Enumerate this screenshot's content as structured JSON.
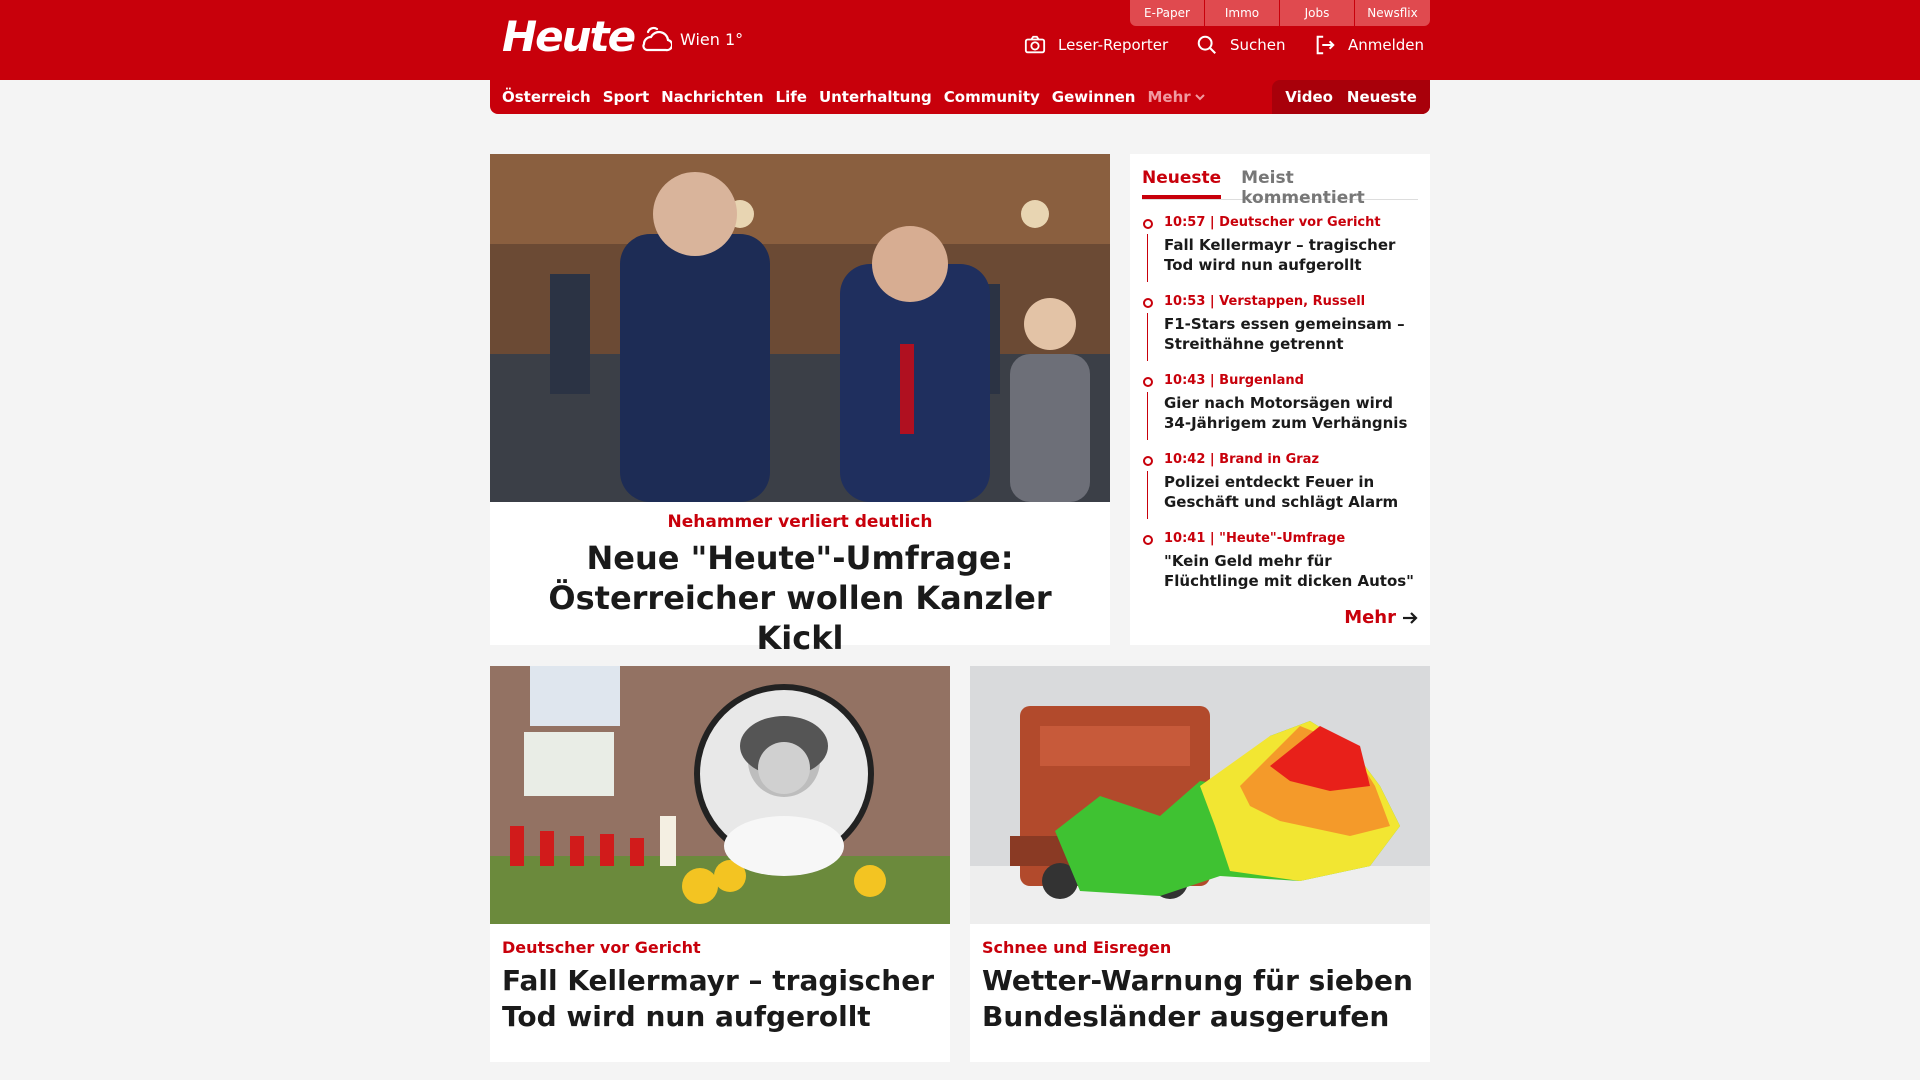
{
  "brand": {
    "logo": "Heute",
    "weather": "Wien 1°",
    "accent": "#c8000b"
  },
  "top_tabs": [
    "E-Paper",
    "Immo",
    "Jobs",
    "Newsflix"
  ],
  "header_actions": {
    "reporter": "Leser-Reporter",
    "search": "Suchen",
    "login": "Anmelden"
  },
  "nav": {
    "items": [
      "Österreich",
      "Sport",
      "Nachrichten",
      "Life",
      "Unterhaltung",
      "Community",
      "Gewinnen"
    ],
    "more": "Mehr",
    "right": [
      "Video",
      "Neueste"
    ]
  },
  "hero": {
    "kicker": "Nehammer verliert deutlich",
    "title": "Neue \"Heute\"-Umfrage: Österreicher wollen Kanzler Kickl"
  },
  "sidebar": {
    "tabs": [
      "Neueste",
      "Meist kommentiert"
    ],
    "items": [
      {
        "meta": "10:57 | Deutscher vor Gericht",
        "title": "Fall Kellermayr – tragischer Tod wird nun aufgerollt"
      },
      {
        "meta": "10:53 | Verstappen, Russell",
        "title": "F1-Stars essen gemeinsam – Streithähne getrennt"
      },
      {
        "meta": "10:43 | Burgenland",
        "title": "Gier nach Motorsägen wird 34-Jährigem zum Verhängnis"
      },
      {
        "meta": "10:42 | Brand in Graz",
        "title": "Polizei entdeckt Feuer in Geschäft und schlägt Alarm"
      },
      {
        "meta": "10:41 | \"Heute\"-Umfrage",
        "title": "\"Kein Geld mehr für Flüchtlinge mit dicken Autos\""
      }
    ],
    "more": "Mehr"
  },
  "cards": [
    {
      "kicker": "Deutscher vor Gericht",
      "title": "Fall Kellermayr – tragischer Tod wird nun aufgerollt"
    },
    {
      "kicker": "Schnee und Eisregen",
      "title": "Wetter-Warnung für sieben Bundesländer ausgerufen"
    }
  ]
}
